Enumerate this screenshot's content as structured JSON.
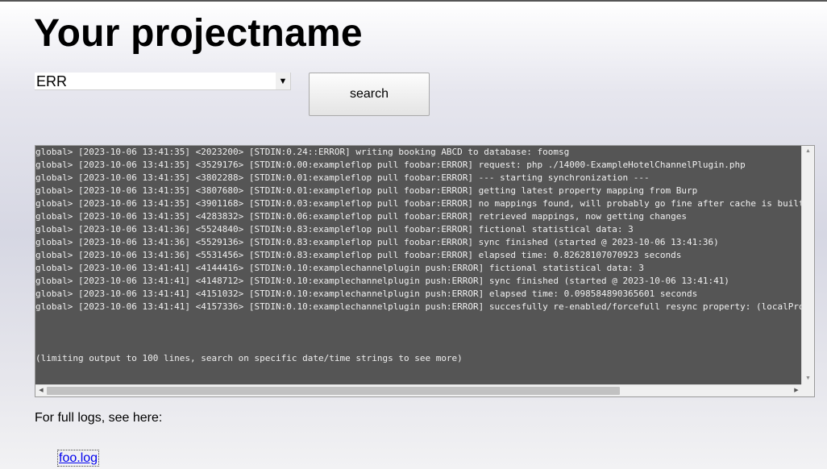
{
  "page": {
    "title": "Your projectname"
  },
  "filter": {
    "selected": "ERR"
  },
  "search_button": {
    "label": "search"
  },
  "log": {
    "lines": [
      "global> [2023-10-06 13:41:35] <2023200> [STDIN:0.24::ERROR] writing booking ABCD to database: foomsg",
      "global> [2023-10-06 13:41:35] <3529176> [STDIN:0.00:exampleflop pull foobar:ERROR] request: php ./14000-ExampleHotelChannelPlugin.php",
      "global> [2023-10-06 13:41:35] <3802288> [STDIN:0.01:exampleflop pull foobar:ERROR] --- starting synchronization ---",
      "global> [2023-10-06 13:41:35] <3807680> [STDIN:0.01:exampleflop pull foobar:ERROR] getting latest property mapping from Burp",
      "global> [2023-10-06 13:41:35] <3901168> [STDIN:0.03:exampleflop pull foobar:ERROR] no mappings found, will probably go fine after cache is built",
      "global> [2023-10-06 13:41:35] <4283832> [STDIN:0.06:exampleflop pull foobar:ERROR] retrieved mappings, now getting changes",
      "global> [2023-10-06 13:41:36] <5524840> [STDIN:0.83:exampleflop pull foobar:ERROR] fictional statistical data: 3",
      "global> [2023-10-06 13:41:36] <5529136> [STDIN:0.83:exampleflop pull foobar:ERROR] sync finished (started @ 2023-10-06 13:41:36)",
      "global> [2023-10-06 13:41:36] <5531456> [STDIN:0.83:exampleflop pull foobar:ERROR] elapsed time: 0.82628107070923 seconds",
      "global> [2023-10-06 13:41:41] <4144416> [STDIN:0.10:examplechannelplugin push:ERROR] fictional statistical data: 3",
      "global> [2023-10-06 13:41:41] <4148712> [STDIN:0.10:examplechannelplugin push:ERROR] sync finished (started @ 2023-10-06 13:41:41)",
      "global> [2023-10-06 13:41:41] <4151032> [STDIN:0.10:examplechannelplugin push:ERROR] elapsed time: 0.098584890365601 seconds",
      "global> [2023-10-06 13:41:41] <4157336> [STDIN:0.10:examplechannelplugin push:ERROR] succesfully re-enabled/forcefull resync property: (localPro",
      "",
      "",
      "",
      "(limiting output to 100 lines, search on specific date/time strings to see more)"
    ]
  },
  "footer": {
    "full_logs_text": "For full logs, see here:",
    "link_text": "foo.log"
  },
  "icons": {
    "select_arrow": "dropdown-arrow-icon",
    "scroll_up": "scroll-up-arrow-icon",
    "scroll_down": "scroll-down-arrow-icon",
    "scroll_left": "scroll-left-arrow-icon",
    "scroll_right": "scroll-right-arrow-icon"
  },
  "colors": {
    "log_background": "#555555",
    "log_text": "#f0f0f0",
    "link": "#0000ee"
  }
}
